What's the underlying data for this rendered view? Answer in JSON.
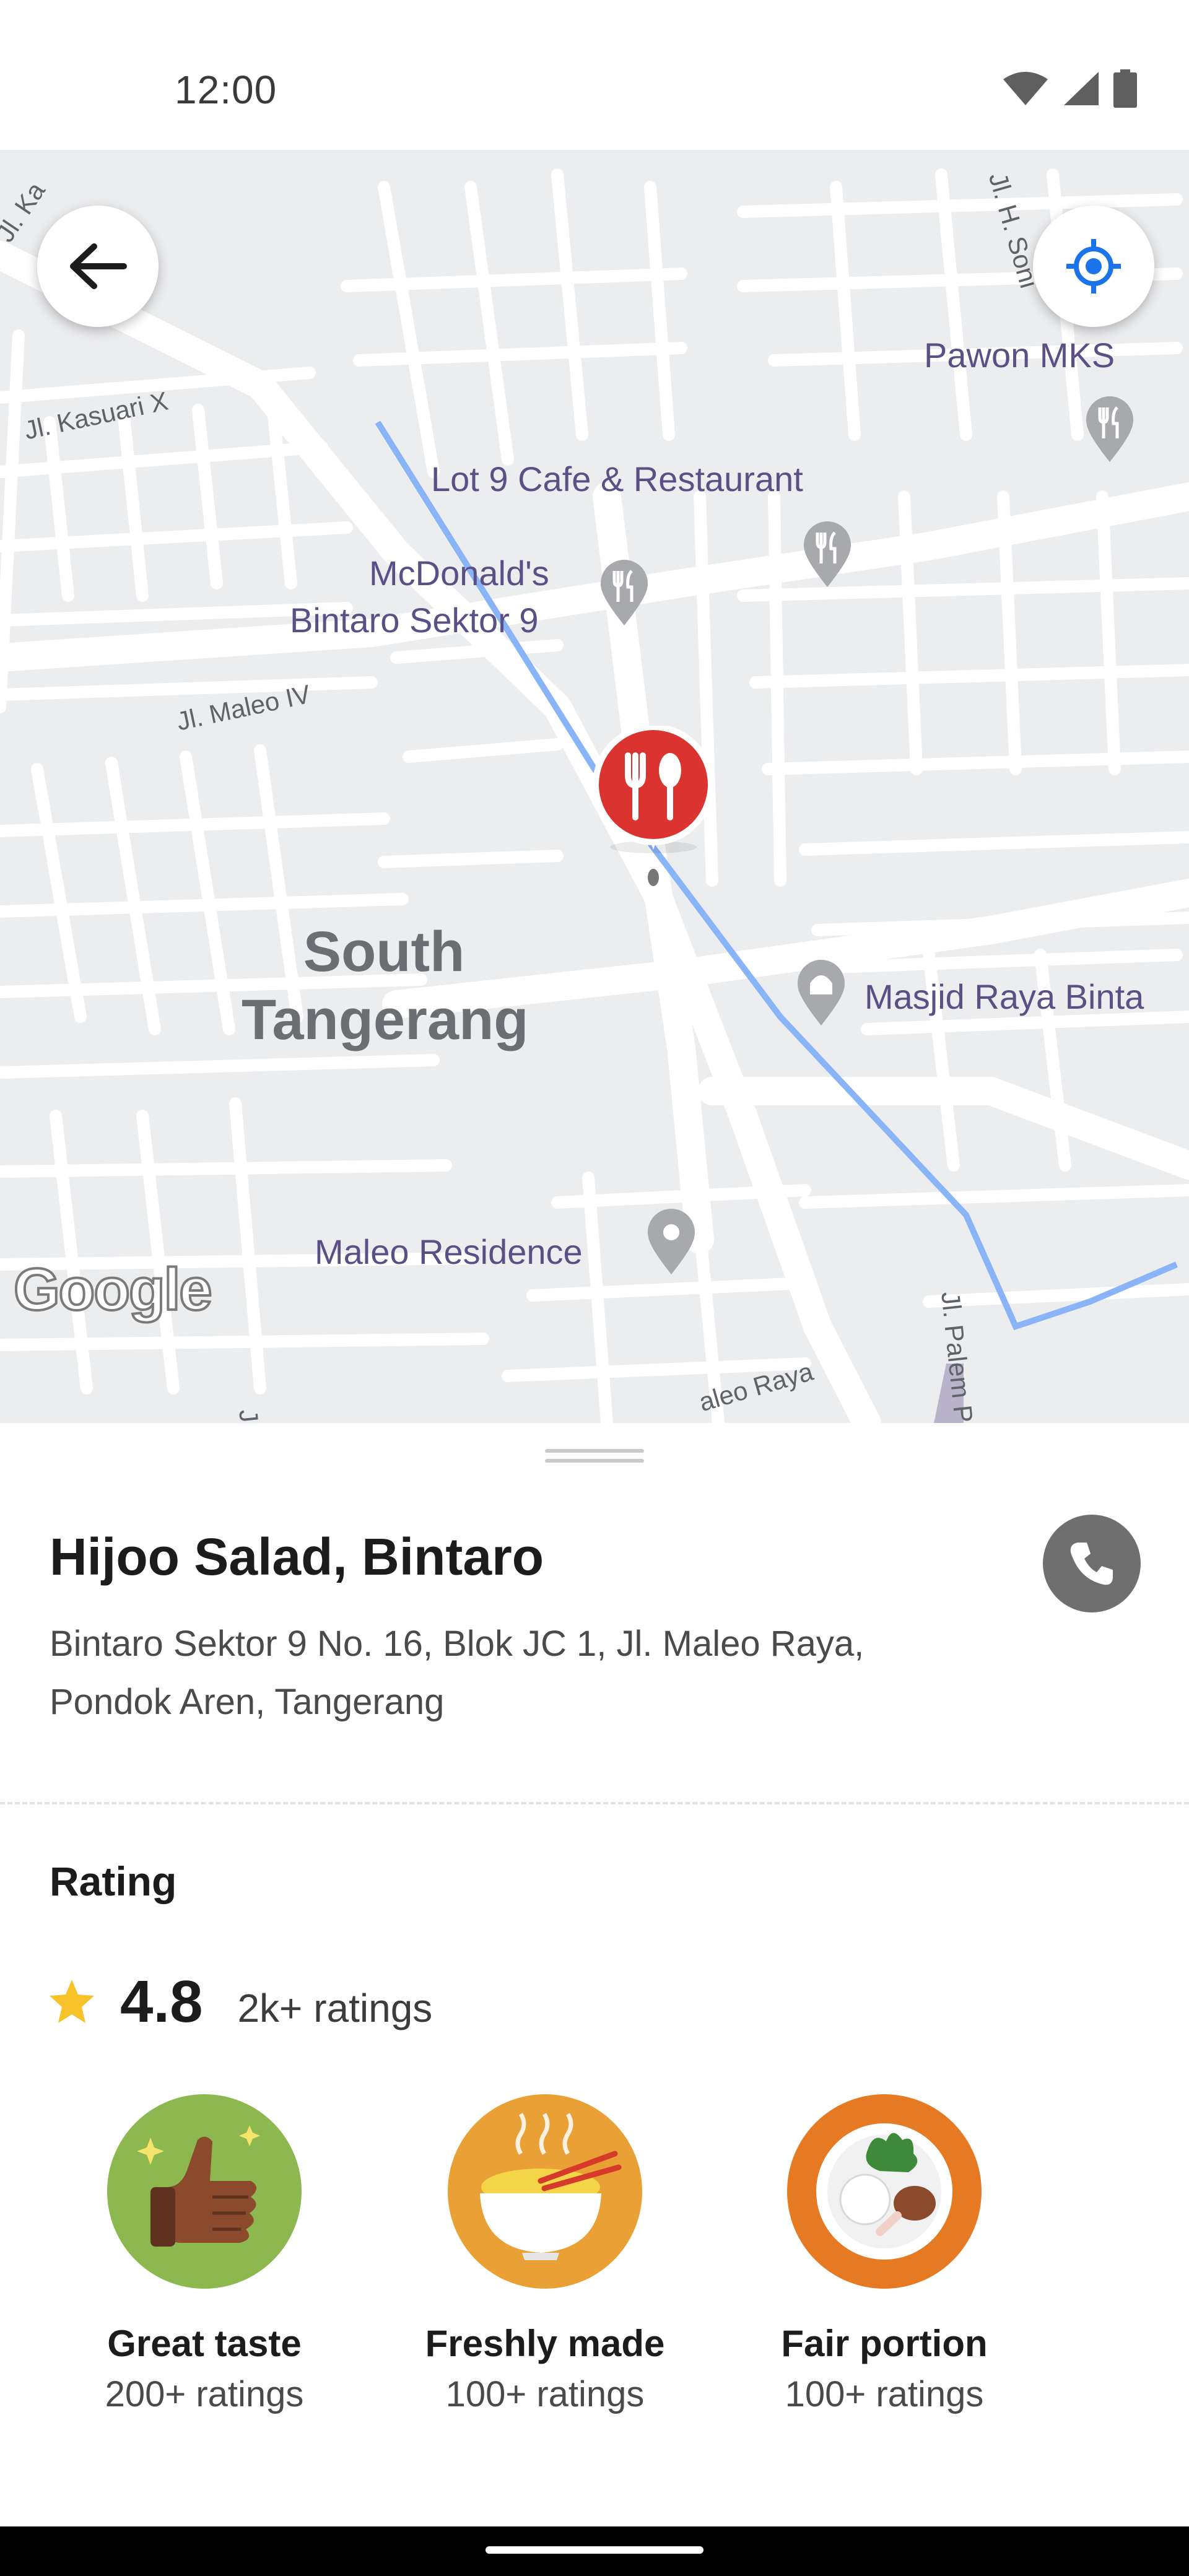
{
  "status_bar": {
    "time": "12:00"
  },
  "map": {
    "street_labels": [
      "Jl. Kasuari X",
      "Jl. Maleo IV",
      "Jl. Palem P",
      "Jl. H. Soni",
      "aleo Raya",
      "Jl. Ka",
      "Jl."
    ],
    "places": [
      "Pawon MKS",
      "Lot 9 Cafe & Restaurant",
      "McDonald's",
      "Bintaro Sektor 9",
      "Masjid Raya Binta",
      "Maleo Residence"
    ],
    "area_name_line1": "South",
    "area_name_line2": "Tangerang",
    "attribution": "Google"
  },
  "restaurant": {
    "name": "Hijoo Salad, Bintaro",
    "address_line1": "Bintaro Sektor 9 No. 16, Blok JC 1, Jl. Maleo Raya,",
    "address_line2": "Pondok Aren, Tangerang"
  },
  "rating": {
    "heading": "Rating",
    "value": "4.8",
    "count": "2k+ ratings",
    "badges": [
      {
        "label": "Great taste",
        "sub": "200+ ratings",
        "color": "#8cb84f"
      },
      {
        "label": "Freshly made",
        "sub": "100+ ratings",
        "color": "#e9a035"
      },
      {
        "label": "Fair portion",
        "sub": "100+ ratings",
        "color": "#e67a23"
      }
    ]
  },
  "colors": {
    "pin_red": "#db3330",
    "locate_blue": "#1a73e8",
    "star_yellow": "#f7c22a",
    "call_grey": "#6f6f6f"
  },
  "icons": {
    "back": "arrow-left-icon",
    "locate": "crosshair-icon",
    "call": "phone-icon",
    "star": "star-icon",
    "pin": "restaurant-pin-icon"
  }
}
